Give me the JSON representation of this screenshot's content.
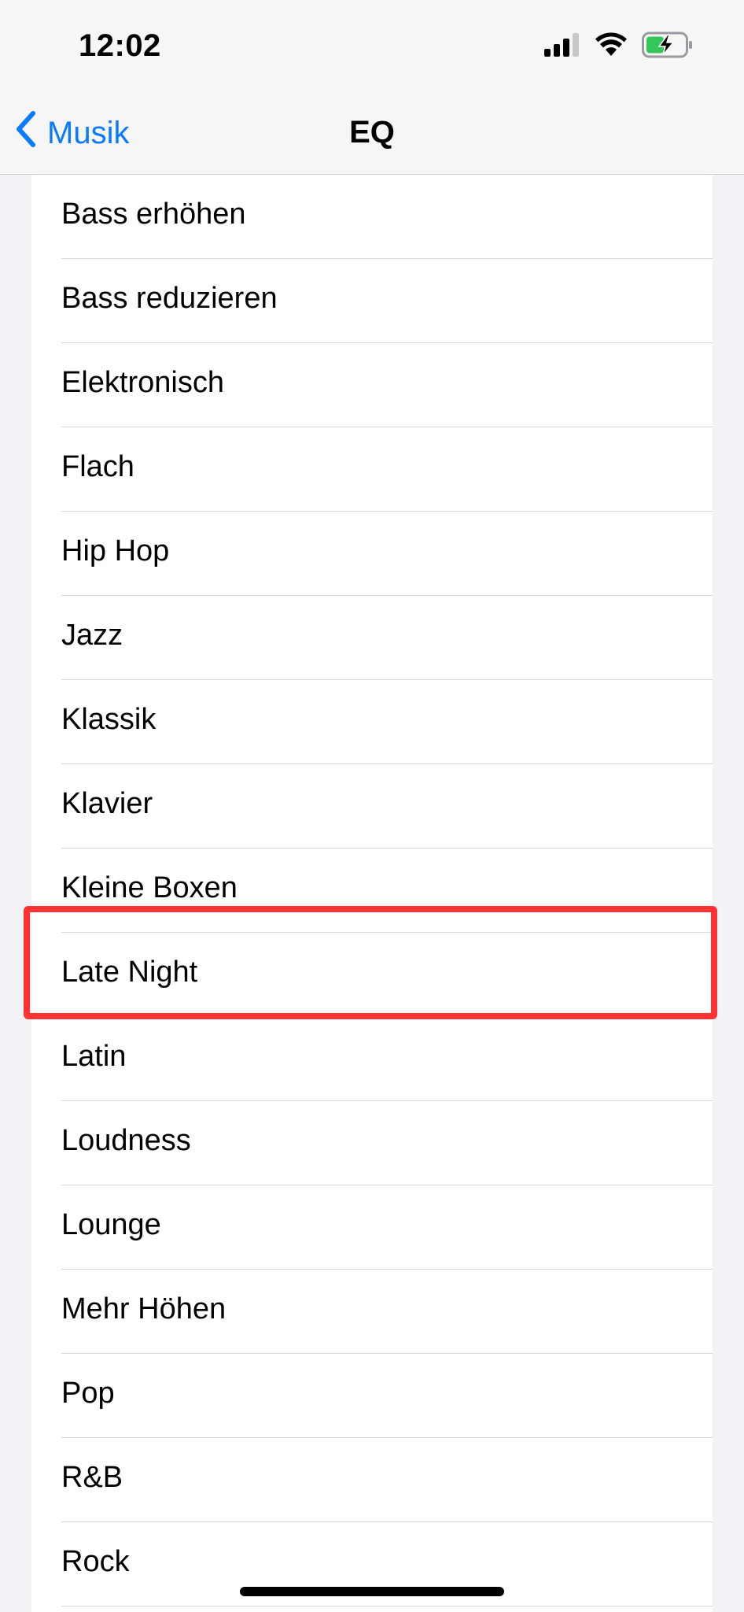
{
  "status_bar": {
    "time": "12:02",
    "icons": [
      "cellular-signal-icon",
      "wifi-icon",
      "battery-charging-icon"
    ],
    "battery_color": "#35c759"
  },
  "nav": {
    "back_label": "Musik",
    "title": "EQ",
    "accent_color": "#0a7aff"
  },
  "eq_presets": [
    {
      "label": "Bass erhöhen"
    },
    {
      "label": "Bass reduzieren"
    },
    {
      "label": "Elektronisch"
    },
    {
      "label": "Flach"
    },
    {
      "label": "Hip Hop"
    },
    {
      "label": "Jazz"
    },
    {
      "label": "Klassik"
    },
    {
      "label": "Klavier"
    },
    {
      "label": "Kleine Boxen"
    },
    {
      "label": "Late Night"
    },
    {
      "label": "Latin"
    },
    {
      "label": "Loudness"
    },
    {
      "label": "Lounge"
    },
    {
      "label": "Mehr Höhen"
    },
    {
      "label": "Pop"
    },
    {
      "label": "R&B"
    },
    {
      "label": "Rock"
    }
  ],
  "highlight": {
    "item": "Late Night",
    "color": "#ff3334"
  }
}
